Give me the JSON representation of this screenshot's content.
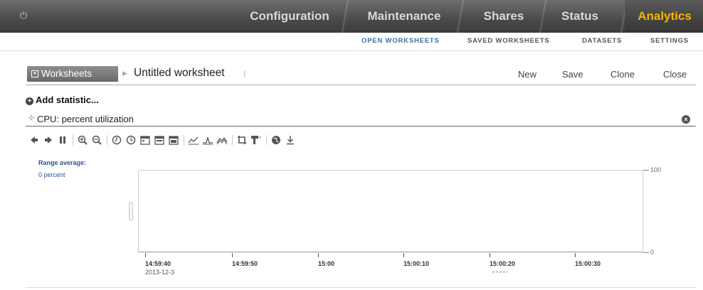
{
  "topnav": {
    "tabs": [
      {
        "label": "Configuration"
      },
      {
        "label": "Maintenance"
      },
      {
        "label": "Shares"
      },
      {
        "label": "Status"
      },
      {
        "label": "Analytics"
      }
    ],
    "active_color": "#f5b400"
  },
  "subnav": {
    "items": [
      "OPEN WORKSHEETS",
      "SAVED WORKSHEETS",
      "DATASETS",
      "SETTINGS"
    ],
    "active_color": "#3b6fa6"
  },
  "worksheet": {
    "menu_label": "Worksheets",
    "title": "Untitled worksheet",
    "actions": [
      "New",
      "Save",
      "Clone",
      "Close"
    ]
  },
  "add_statistic": "Add statistic...",
  "statistic": {
    "label": "CPU: percent utilization"
  },
  "toolbar_icons": [
    "back-icon",
    "forward-icon",
    "pause-icon",
    "zoom-in-icon",
    "zoom-out-icon",
    "clock-back-icon",
    "clock-forward-icon",
    "calendar-day-icon",
    "calendar-week-icon",
    "calendar-month-icon",
    "line-chart-icon",
    "peak-chart-icon",
    "area-chart-icon",
    "crop-icon",
    "drilldown-icon",
    "globe-icon",
    "download-icon"
  ],
  "range": {
    "label": "Range average:",
    "value": "0 percent"
  },
  "chart_data": {
    "type": "line",
    "x": [
      "14:59:40",
      "14:59:50",
      "15:00",
      "15:00:10",
      "15:00:20",
      "15:00:30"
    ],
    "date_label": "2013-12-3",
    "ylim": [
      0,
      100
    ],
    "yticks": [
      "100",
      "0"
    ],
    "series": []
  }
}
